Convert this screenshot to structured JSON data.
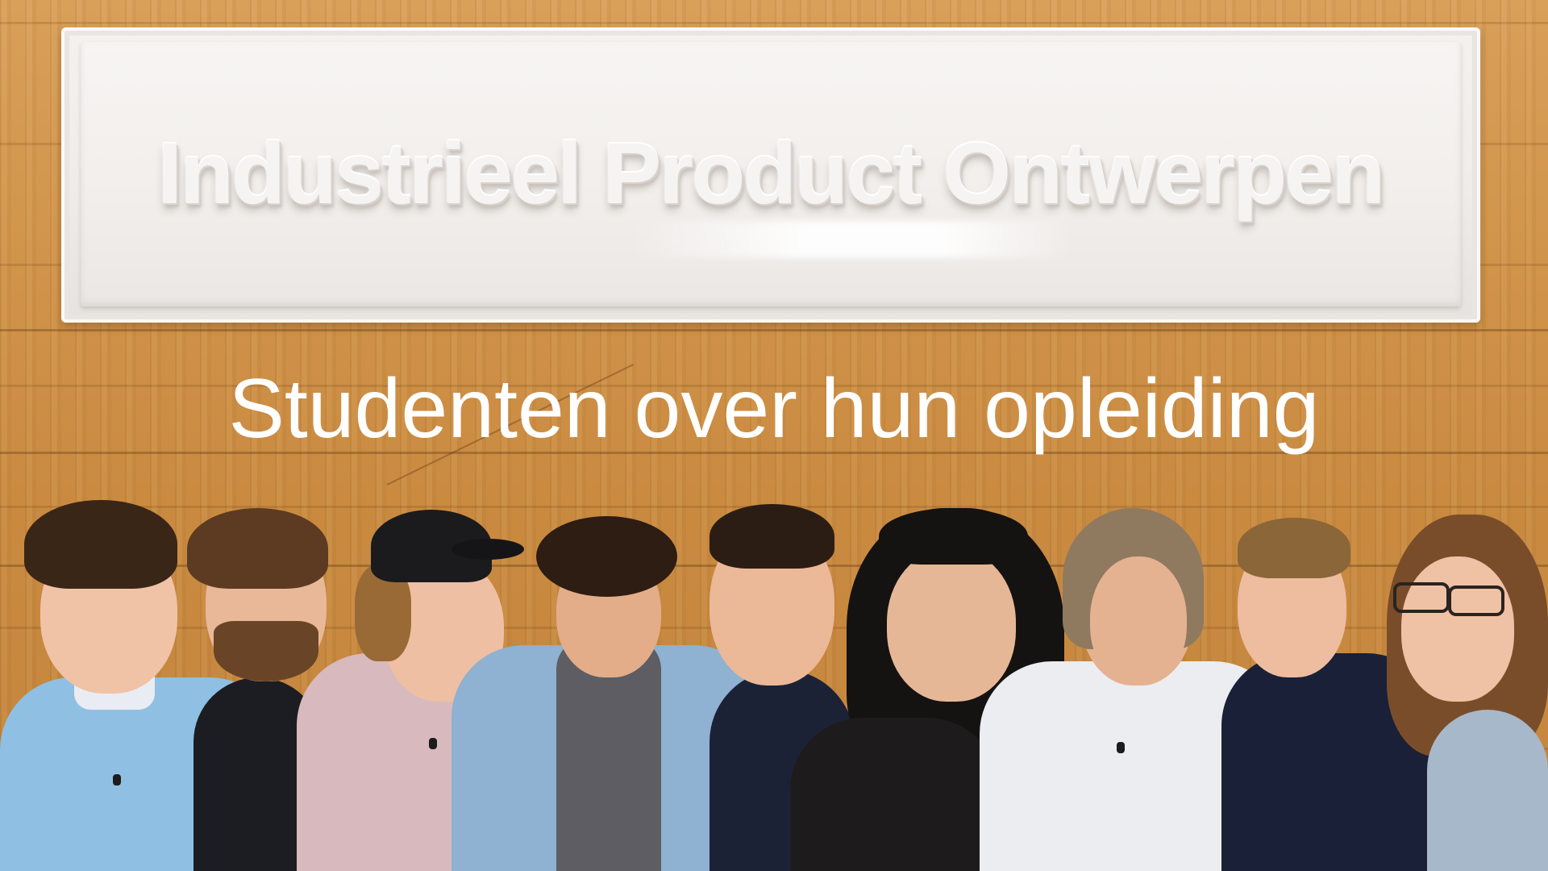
{
  "plaque": {
    "text": "Industrieel Product Ontwerpen"
  },
  "headline": {
    "text": "Studenten over hun opleiding"
  },
  "colors": {
    "wood": "#c98e45",
    "plaque": "#f2efec",
    "headline": "#ffffff"
  }
}
